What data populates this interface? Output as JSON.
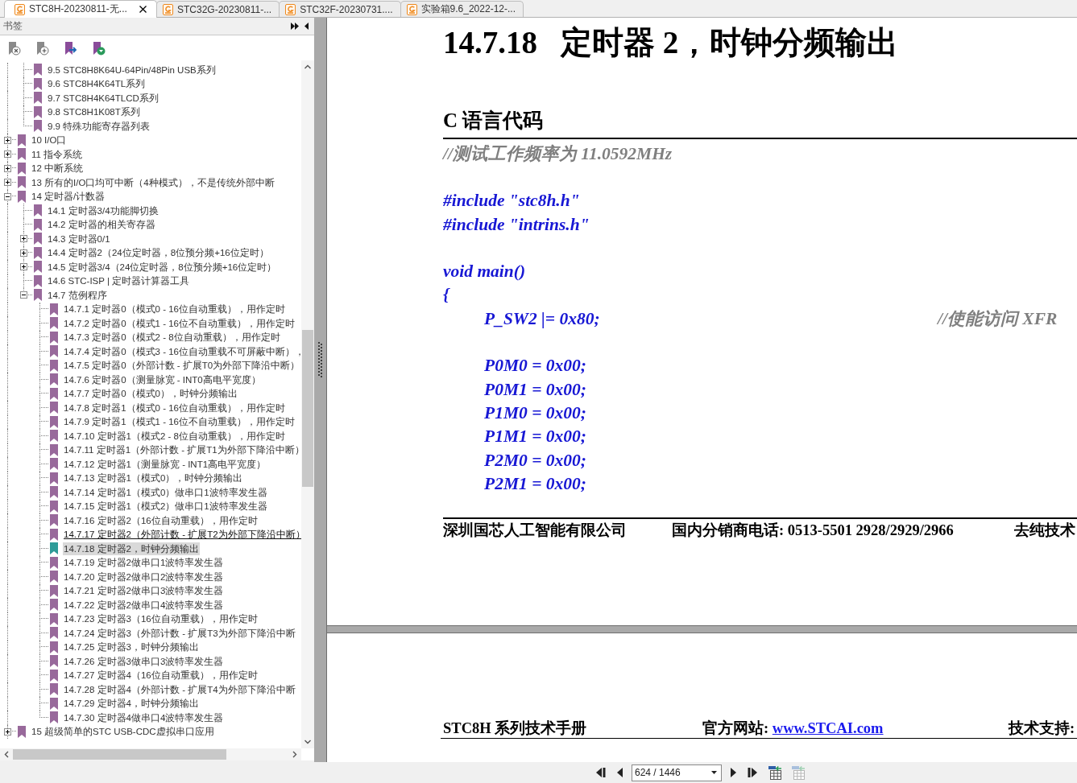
{
  "tabs": [
    {
      "label": "STC8H-20230811-无...",
      "selected": true
    },
    {
      "label": "STC32G-20230811-...",
      "selected": false
    },
    {
      "label": "STC32F-20230731....",
      "selected": false
    },
    {
      "label": "实验箱9.6_2022-12-...",
      "selected": false
    }
  ],
  "sidebar": {
    "title": "书签",
    "tree": {
      "continued_items": [
        {
          "label": "9.5 STC8H8K64U-64Pin/48Pin USB系列",
          "selected": false,
          "hovered": false
        },
        {
          "label": "9.6 STC8H4K64TL系列",
          "selected": false,
          "hovered": false
        },
        {
          "label": "9.7 STC8H4K64TLCD系列",
          "selected": false,
          "hovered": false
        },
        {
          "label": "9.8 STC8H1K08T系列",
          "selected": false,
          "hovered": false
        },
        {
          "label": "9.9 特殊功能寄存器列表",
          "selected": false,
          "hovered": false
        }
      ],
      "items": [
        {
          "label": "10 I/O口",
          "expanded": false,
          "selected": false,
          "hovered": false
        },
        {
          "label": "11 指令系统",
          "expanded": false,
          "selected": false,
          "hovered": false
        },
        {
          "label": "12 中断系统",
          "expanded": false,
          "selected": false,
          "hovered": false
        },
        {
          "label": "13 所有的I/O口均可中断（4种模式），不是传统外部中断",
          "expanded": false,
          "selected": false,
          "hovered": false
        },
        {
          "label": "14 定时器/计数器",
          "expanded": true,
          "selected": false,
          "hovered": false,
          "children": [
            {
              "label": "14.1 定时器3/4功能脚切换",
              "selected": false,
              "hovered": false
            },
            {
              "label": "14.2 定时器的相关寄存器",
              "selected": false,
              "hovered": false
            },
            {
              "label": "14.3 定时器0/1",
              "expanded": false,
              "selected": false,
              "hovered": false
            },
            {
              "label": "14.4 定时器2（24位定时器，8位预分频+16位定时）",
              "expanded": false,
              "selected": false,
              "hovered": false
            },
            {
              "label": "14.5 定时器3/4（24位定时器，8位预分频+16位定时）",
              "expanded": false,
              "selected": false,
              "hovered": false
            },
            {
              "label": "14.6 STC-ISP | 定时器计算器工具",
              "selected": false,
              "hovered": false
            },
            {
              "label": "14.7 范例程序",
              "expanded": true,
              "selected": false,
              "hovered": false,
              "children": [
                {
                  "label": "14.7.1 定时器0（模式0 - 16位自动重载），用作定时",
                  "selected": false,
                  "hovered": false
                },
                {
                  "label": "14.7.2 定时器0（模式1 - 16位不自动重载），用作定时",
                  "selected": false,
                  "hovered": false
                },
                {
                  "label": "14.7.3 定时器0（模式2 - 8位自动重载），用作定时",
                  "selected": false,
                  "hovered": false
                },
                {
                  "label": "14.7.4 定时器0（模式3 - 16位自动重载不可屏蔽中断），",
                  "selected": false,
                  "hovered": false
                },
                {
                  "label": "14.7.5 定时器0（外部计数 - 扩展T0为外部下降沿中断）",
                  "selected": false,
                  "hovered": false
                },
                {
                  "label": "14.7.6 定时器0（测量脉宽 - INT0高电平宽度）",
                  "selected": false,
                  "hovered": false
                },
                {
                  "label": "14.7.7 定时器0（模式0），时钟分频输出",
                  "selected": false,
                  "hovered": false
                },
                {
                  "label": "14.7.8 定时器1（模式0 - 16位自动重载），用作定时",
                  "selected": false,
                  "hovered": false
                },
                {
                  "label": "14.7.9 定时器1（模式1 - 16位不自动重载），用作定时",
                  "selected": false,
                  "hovered": false
                },
                {
                  "label": "14.7.10 定时器1（模式2 - 8位自动重载），用作定时",
                  "selected": false,
                  "hovered": false
                },
                {
                  "label": "14.7.11 定时器1（外部计数 - 扩展T1为外部下降沿中断）",
                  "selected": false,
                  "hovered": false
                },
                {
                  "label": "14.7.12 定时器1（测量脉宽 - INT1高电平宽度）",
                  "selected": false,
                  "hovered": false
                },
                {
                  "label": "14.7.13 定时器1（模式0），时钟分频输出",
                  "selected": false,
                  "hovered": false
                },
                {
                  "label": "14.7.14 定时器1（模式0）做串口1波特率发生器",
                  "selected": false,
                  "hovered": false
                },
                {
                  "label": "14.7.15 定时器1（模式2）做串口1波特率发生器",
                  "selected": false,
                  "hovered": false
                },
                {
                  "label": "14.7.16 定时器2（16位自动重载），用作定时",
                  "selected": false,
                  "hovered": false
                },
                {
                  "label": "14.7.17 定时器2（外部计数 - 扩展T2为外部下降沿中断）",
                  "selected": false,
                  "hovered": true
                },
                {
                  "label": "14.7.18 定时器2，时钟分频输出",
                  "selected": true,
                  "hovered": false
                },
                {
                  "label": "14.7.19 定时器2做串口1波特率发生器",
                  "selected": false,
                  "hovered": false
                },
                {
                  "label": "14.7.20 定时器2做串口2波特率发生器",
                  "selected": false,
                  "hovered": false
                },
                {
                  "label": "14.7.21 定时器2做串口3波特率发生器",
                  "selected": false,
                  "hovered": false
                },
                {
                  "label": "14.7.22 定时器2做串口4波特率发生器",
                  "selected": false,
                  "hovered": false
                },
                {
                  "label": "14.7.23 定时器3（16位自动重载），用作定时",
                  "selected": false,
                  "hovered": false
                },
                {
                  "label": "14.7.24 定时器3（外部计数 - 扩展T3为外部下降沿中断",
                  "selected": false,
                  "hovered": false
                },
                {
                  "label": "14.7.25 定时器3，时钟分频输出",
                  "selected": false,
                  "hovered": false
                },
                {
                  "label": "14.7.26 定时器3做串口3波特率发生器",
                  "selected": false,
                  "hovered": false
                },
                {
                  "label": "14.7.27 定时器4（16位自动重载），用作定时",
                  "selected": false,
                  "hovered": false
                },
                {
                  "label": "14.7.28 定时器4（外部计数 - 扩展T4为外部下降沿中断",
                  "selected": false,
                  "hovered": false
                },
                {
                  "label": "14.7.29 定时器4，时钟分频输出",
                  "selected": false,
                  "hovered": false
                },
                {
                  "label": "14.7.30 定时器4做串口4波特率发生器",
                  "selected": false,
                  "hovered": false
                }
              ]
            }
          ]
        },
        {
          "label": "15 超级简单的STC USB-CDC虚拟串口应用",
          "expanded": false,
          "selected": false,
          "hovered": false
        }
      ]
    }
  },
  "document": {
    "current_page": {
      "heading_number": "14.7.18",
      "heading_title": "定时器 2，时钟分频输出",
      "section_title": "C 语言代码",
      "code_lines": [
        {
          "kind": "comment",
          "text": "//测试工作频率为 11.0592MHz"
        },
        {
          "kind": "blank"
        },
        {
          "kind": "code",
          "text": "#include \"stc8h.h\""
        },
        {
          "kind": "code",
          "text": "#include \"intrins.h\""
        },
        {
          "kind": "blank"
        },
        {
          "kind": "code",
          "text": "void main()"
        },
        {
          "kind": "code",
          "text": "{",
          "children": [
            {
              "kind": "code",
              "text": "P_SW2 |= 0x80;",
              "comment": "//使能访问 XFR"
            },
            {
              "kind": "blank"
            },
            {
              "kind": "code",
              "text": "P0M0 = 0x00;"
            },
            {
              "kind": "code",
              "text": "P0M1 = 0x00;"
            },
            {
              "kind": "code",
              "text": "P1M0 = 0x00;"
            },
            {
              "kind": "code",
              "text": "P1M1 = 0x00;"
            },
            {
              "kind": "code",
              "text": "P2M0 = 0x00;"
            },
            {
              "kind": "code",
              "text": "P2M1 = 0x00;"
            }
          ]
        }
      ],
      "footer": [
        "深圳国芯人工智能有限公司",
        "国内分销商电话: 0513-5501 2928/2929/2966",
        "去纯技术"
      ]
    },
    "next_page": {
      "header": [
        {
          "text": "STC8H 系列技术手册"
        },
        {
          "text": "官方网站:",
          "link": "www.STCAI.com"
        },
        {
          "text": "技术支持:"
        }
      ]
    }
  },
  "page_navigation": {
    "page_field": "624 / 1446",
    "view_buttons": [
      {
        "disabled": false
      },
      {
        "disabled": true
      }
    ]
  }
}
